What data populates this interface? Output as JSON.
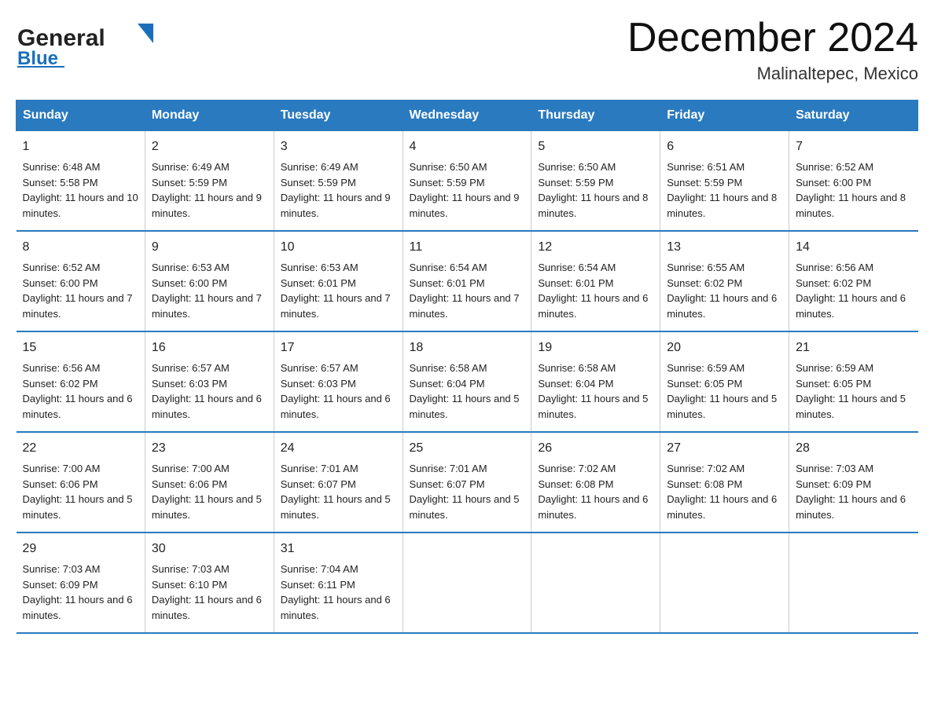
{
  "header": {
    "logo_general": "General",
    "logo_blue": "Blue",
    "month_title": "December 2024",
    "location": "Malinaltepec, Mexico"
  },
  "days_of_week": [
    "Sunday",
    "Monday",
    "Tuesday",
    "Wednesday",
    "Thursday",
    "Friday",
    "Saturday"
  ],
  "weeks": [
    [
      {
        "day": "1",
        "sunrise": "Sunrise: 6:48 AM",
        "sunset": "Sunset: 5:58 PM",
        "daylight": "Daylight: 11 hours and 10 minutes."
      },
      {
        "day": "2",
        "sunrise": "Sunrise: 6:49 AM",
        "sunset": "Sunset: 5:59 PM",
        "daylight": "Daylight: 11 hours and 9 minutes."
      },
      {
        "day": "3",
        "sunrise": "Sunrise: 6:49 AM",
        "sunset": "Sunset: 5:59 PM",
        "daylight": "Daylight: 11 hours and 9 minutes."
      },
      {
        "day": "4",
        "sunrise": "Sunrise: 6:50 AM",
        "sunset": "Sunset: 5:59 PM",
        "daylight": "Daylight: 11 hours and 9 minutes."
      },
      {
        "day": "5",
        "sunrise": "Sunrise: 6:50 AM",
        "sunset": "Sunset: 5:59 PM",
        "daylight": "Daylight: 11 hours and 8 minutes."
      },
      {
        "day": "6",
        "sunrise": "Sunrise: 6:51 AM",
        "sunset": "Sunset: 5:59 PM",
        "daylight": "Daylight: 11 hours and 8 minutes."
      },
      {
        "day": "7",
        "sunrise": "Sunrise: 6:52 AM",
        "sunset": "Sunset: 6:00 PM",
        "daylight": "Daylight: 11 hours and 8 minutes."
      }
    ],
    [
      {
        "day": "8",
        "sunrise": "Sunrise: 6:52 AM",
        "sunset": "Sunset: 6:00 PM",
        "daylight": "Daylight: 11 hours and 7 minutes."
      },
      {
        "day": "9",
        "sunrise": "Sunrise: 6:53 AM",
        "sunset": "Sunset: 6:00 PM",
        "daylight": "Daylight: 11 hours and 7 minutes."
      },
      {
        "day": "10",
        "sunrise": "Sunrise: 6:53 AM",
        "sunset": "Sunset: 6:01 PM",
        "daylight": "Daylight: 11 hours and 7 minutes."
      },
      {
        "day": "11",
        "sunrise": "Sunrise: 6:54 AM",
        "sunset": "Sunset: 6:01 PM",
        "daylight": "Daylight: 11 hours and 7 minutes."
      },
      {
        "day": "12",
        "sunrise": "Sunrise: 6:54 AM",
        "sunset": "Sunset: 6:01 PM",
        "daylight": "Daylight: 11 hours and 6 minutes."
      },
      {
        "day": "13",
        "sunrise": "Sunrise: 6:55 AM",
        "sunset": "Sunset: 6:02 PM",
        "daylight": "Daylight: 11 hours and 6 minutes."
      },
      {
        "day": "14",
        "sunrise": "Sunrise: 6:56 AM",
        "sunset": "Sunset: 6:02 PM",
        "daylight": "Daylight: 11 hours and 6 minutes."
      }
    ],
    [
      {
        "day": "15",
        "sunrise": "Sunrise: 6:56 AM",
        "sunset": "Sunset: 6:02 PM",
        "daylight": "Daylight: 11 hours and 6 minutes."
      },
      {
        "day": "16",
        "sunrise": "Sunrise: 6:57 AM",
        "sunset": "Sunset: 6:03 PM",
        "daylight": "Daylight: 11 hours and 6 minutes."
      },
      {
        "day": "17",
        "sunrise": "Sunrise: 6:57 AM",
        "sunset": "Sunset: 6:03 PM",
        "daylight": "Daylight: 11 hours and 6 minutes."
      },
      {
        "day": "18",
        "sunrise": "Sunrise: 6:58 AM",
        "sunset": "Sunset: 6:04 PM",
        "daylight": "Daylight: 11 hours and 5 minutes."
      },
      {
        "day": "19",
        "sunrise": "Sunrise: 6:58 AM",
        "sunset": "Sunset: 6:04 PM",
        "daylight": "Daylight: 11 hours and 5 minutes."
      },
      {
        "day": "20",
        "sunrise": "Sunrise: 6:59 AM",
        "sunset": "Sunset: 6:05 PM",
        "daylight": "Daylight: 11 hours and 5 minutes."
      },
      {
        "day": "21",
        "sunrise": "Sunrise: 6:59 AM",
        "sunset": "Sunset: 6:05 PM",
        "daylight": "Daylight: 11 hours and 5 minutes."
      }
    ],
    [
      {
        "day": "22",
        "sunrise": "Sunrise: 7:00 AM",
        "sunset": "Sunset: 6:06 PM",
        "daylight": "Daylight: 11 hours and 5 minutes."
      },
      {
        "day": "23",
        "sunrise": "Sunrise: 7:00 AM",
        "sunset": "Sunset: 6:06 PM",
        "daylight": "Daylight: 11 hours and 5 minutes."
      },
      {
        "day": "24",
        "sunrise": "Sunrise: 7:01 AM",
        "sunset": "Sunset: 6:07 PM",
        "daylight": "Daylight: 11 hours and 5 minutes."
      },
      {
        "day": "25",
        "sunrise": "Sunrise: 7:01 AM",
        "sunset": "Sunset: 6:07 PM",
        "daylight": "Daylight: 11 hours and 5 minutes."
      },
      {
        "day": "26",
        "sunrise": "Sunrise: 7:02 AM",
        "sunset": "Sunset: 6:08 PM",
        "daylight": "Daylight: 11 hours and 6 minutes."
      },
      {
        "day": "27",
        "sunrise": "Sunrise: 7:02 AM",
        "sunset": "Sunset: 6:08 PM",
        "daylight": "Daylight: 11 hours and 6 minutes."
      },
      {
        "day": "28",
        "sunrise": "Sunrise: 7:03 AM",
        "sunset": "Sunset: 6:09 PM",
        "daylight": "Daylight: 11 hours and 6 minutes."
      }
    ],
    [
      {
        "day": "29",
        "sunrise": "Sunrise: 7:03 AM",
        "sunset": "Sunset: 6:09 PM",
        "daylight": "Daylight: 11 hours and 6 minutes."
      },
      {
        "day": "30",
        "sunrise": "Sunrise: 7:03 AM",
        "sunset": "Sunset: 6:10 PM",
        "daylight": "Daylight: 11 hours and 6 minutes."
      },
      {
        "day": "31",
        "sunrise": "Sunrise: 7:04 AM",
        "sunset": "Sunset: 6:11 PM",
        "daylight": "Daylight: 11 hours and 6 minutes."
      },
      {
        "day": "",
        "sunrise": "",
        "sunset": "",
        "daylight": ""
      },
      {
        "day": "",
        "sunrise": "",
        "sunset": "",
        "daylight": ""
      },
      {
        "day": "",
        "sunrise": "",
        "sunset": "",
        "daylight": ""
      },
      {
        "day": "",
        "sunrise": "",
        "sunset": "",
        "daylight": ""
      }
    ]
  ]
}
